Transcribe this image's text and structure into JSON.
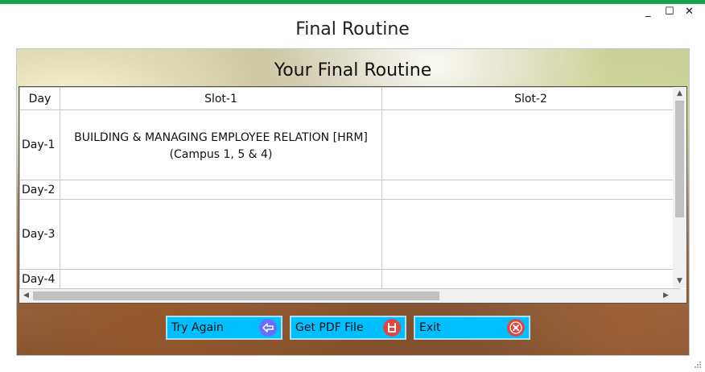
{
  "window": {
    "title": "Final Routine",
    "controls": {
      "minimize": "_",
      "maximize": "☐",
      "close": "✕"
    }
  },
  "panel": {
    "heading": "Your Final Routine"
  },
  "grid": {
    "columns": [
      "Day",
      "Slot-1",
      "Slot-2"
    ],
    "rows": [
      {
        "day": "Day-1",
        "slot1_line1": "BUILDING & MANAGING EMPLOYEE RELATION [HRM]",
        "slot1_line2": "(Campus 1, 5 & 4)",
        "slot2": ""
      },
      {
        "day": "Day-2",
        "slot1": "",
        "slot2": ""
      },
      {
        "day": "Day-3",
        "slot1": "",
        "slot2": ""
      },
      {
        "day": "Day-4",
        "slot1": "",
        "slot2": ""
      }
    ]
  },
  "buttons": {
    "try_again": "Try Again",
    "get_pdf": "Get PDF File",
    "exit": "Exit"
  },
  "icons": {
    "try_again": "arrow-left-icon",
    "get_pdf": "pdf-save-icon",
    "exit": "close-circle-icon"
  },
  "colors": {
    "accent_bar": "#16a34a",
    "button_bg": "#00bfff",
    "try_again_icon": "#6b6bff",
    "pdf_icon": "#e0453f",
    "exit_icon": "#e0453f"
  }
}
